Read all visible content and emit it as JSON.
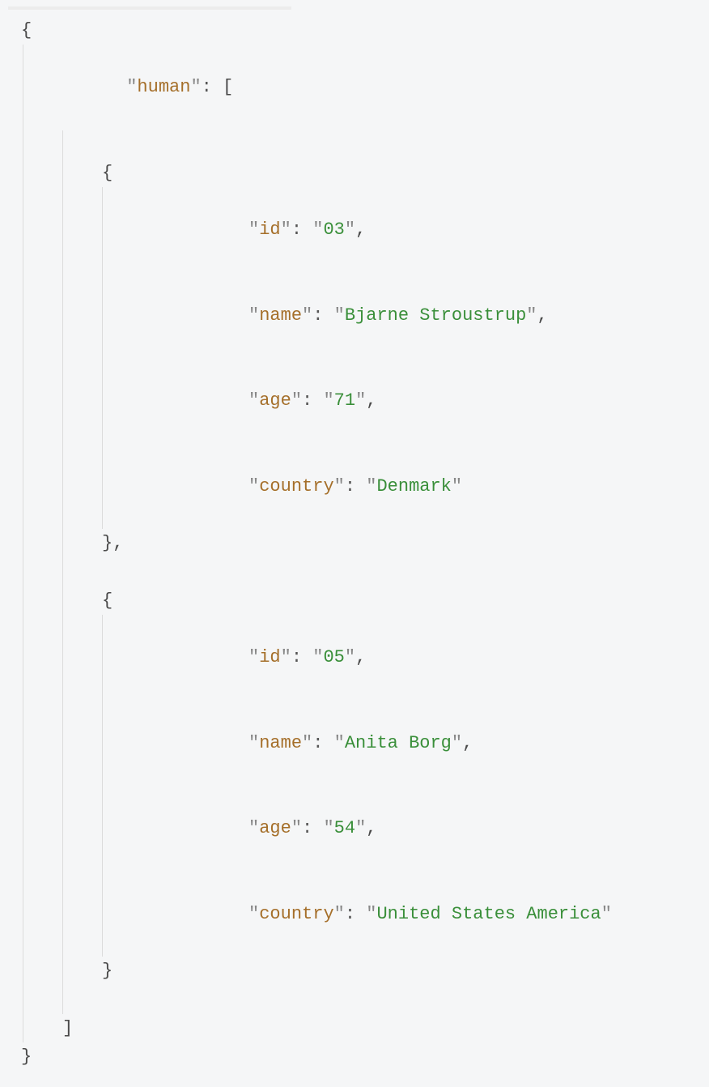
{
  "code": {
    "rootOpen": "{",
    "rootClose": "}",
    "arrayKey": "human",
    "arrayOpen": "[",
    "arrayClose": "]",
    "objOpen": "{",
    "objClose": "}",
    "comma": ",",
    "colon": ":",
    "records": [
      {
        "id_key": "id",
        "id_val": "03",
        "name_key": "name",
        "name_val": "Bjarne Stroustrup",
        "age_key": "age",
        "age_val": "71",
        "country_key": "country",
        "country_val": "Denmark"
      },
      {
        "id_key": "id",
        "id_val": "05",
        "name_key": "name",
        "name_val": "Anita Borg",
        "age_key": "age",
        "age_val": "54",
        "country_key": "country",
        "country_val": "United States America"
      }
    ]
  }
}
